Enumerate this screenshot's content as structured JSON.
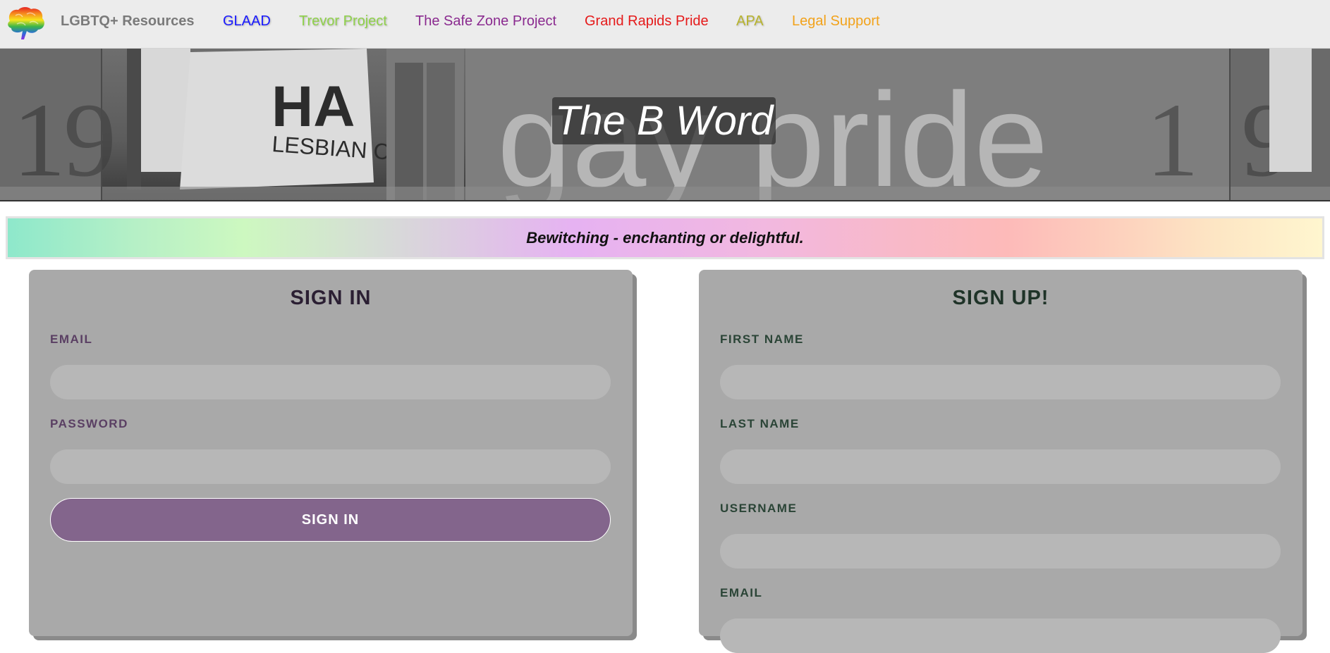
{
  "nav": {
    "brand": "LGBTQ+ Resources",
    "links": [
      {
        "label": "GLAAD",
        "color": "#1a1aff"
      },
      {
        "label": "Trevor Project",
        "color": "#8fd14a"
      },
      {
        "label": "The Safe Zone Project",
        "color": "#8a2a8f"
      },
      {
        "label": "Grand Rapids Pride",
        "color": "#e51a1a"
      },
      {
        "label": "APA",
        "color": "#b8b42e"
      },
      {
        "label": "Legal Support",
        "color": "#f2a21a"
      }
    ]
  },
  "hero": {
    "title": "The B Word"
  },
  "banner": {
    "text": "Bewitching - enchanting or delightful."
  },
  "signin": {
    "title": "SIGN IN",
    "title_color": "#2b1f33",
    "label_color": "#5a3f63",
    "email_label": "EMAIL",
    "password_label": "PASSWORD",
    "button_label": "SIGN IN",
    "button_color": "#83658c"
  },
  "signup": {
    "title": "SIGN UP!",
    "title_color": "#1f3328",
    "label_color": "#2a4436",
    "first_name_label": "FIRST NAME",
    "last_name_label": "LAST NAME",
    "username_label": "USERNAME",
    "email_label": "EMAIL"
  }
}
